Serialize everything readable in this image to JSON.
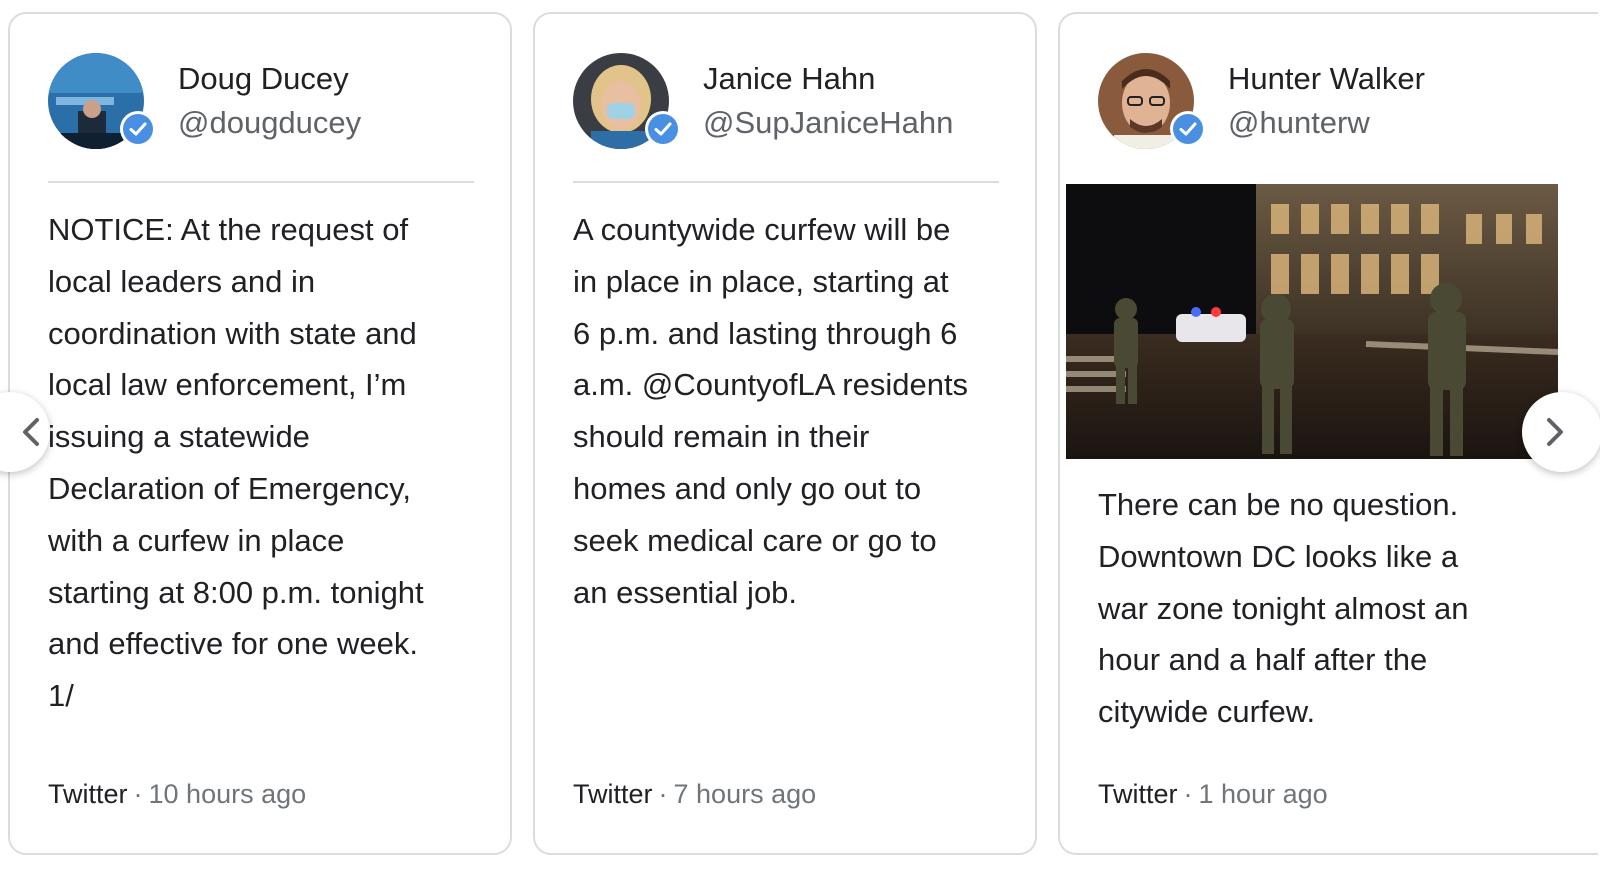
{
  "cards": [
    {
      "name": "Doug Ducey",
      "handle": "@dougducey",
      "verified": true,
      "text": "NOTICE: At the request of\nlocal leaders and in\ncoordination with state and\nlocal law enforcement, I’m\nissuing a statewide\nDeclaration of Emergency,\nwith a curfew in place\nstarting at 8:00 p.m. tonight\nand effective for one week.\n1/",
      "source": "Twitter",
      "separator": "·",
      "time": "10 hours ago"
    },
    {
      "name": "Janice Hahn",
      "handle": "@SupJaniceHahn",
      "verified": true,
      "text": "A countywide curfew will be\nin place in place, starting at\n6 p.m. and lasting through 6\na.m. @CountyofLA residents\nshould remain in their\nhomes and only go out to\nseek medical care or go to\nan essential job.",
      "source": "Twitter",
      "separator": "·",
      "time": "7 hours ago"
    },
    {
      "name": "Hunter Walker",
      "handle": "@hunterw",
      "verified": true,
      "text": "There can be no question.\nDowntown DC looks like a\nwar zone tonight almost an\nhour and a half after the\ncitywide curfew.",
      "source": "Twitter",
      "separator": "·",
      "time": "1 hour ago"
    }
  ],
  "icons": {
    "verified": "verified-badge-icon",
    "prev": "chevron-left-icon",
    "next": "chevron-right-icon"
  },
  "colors": {
    "verified_blue": "#4a90e2",
    "border": "#dadce0",
    "text": "#202124",
    "muted": "#5f6368"
  }
}
